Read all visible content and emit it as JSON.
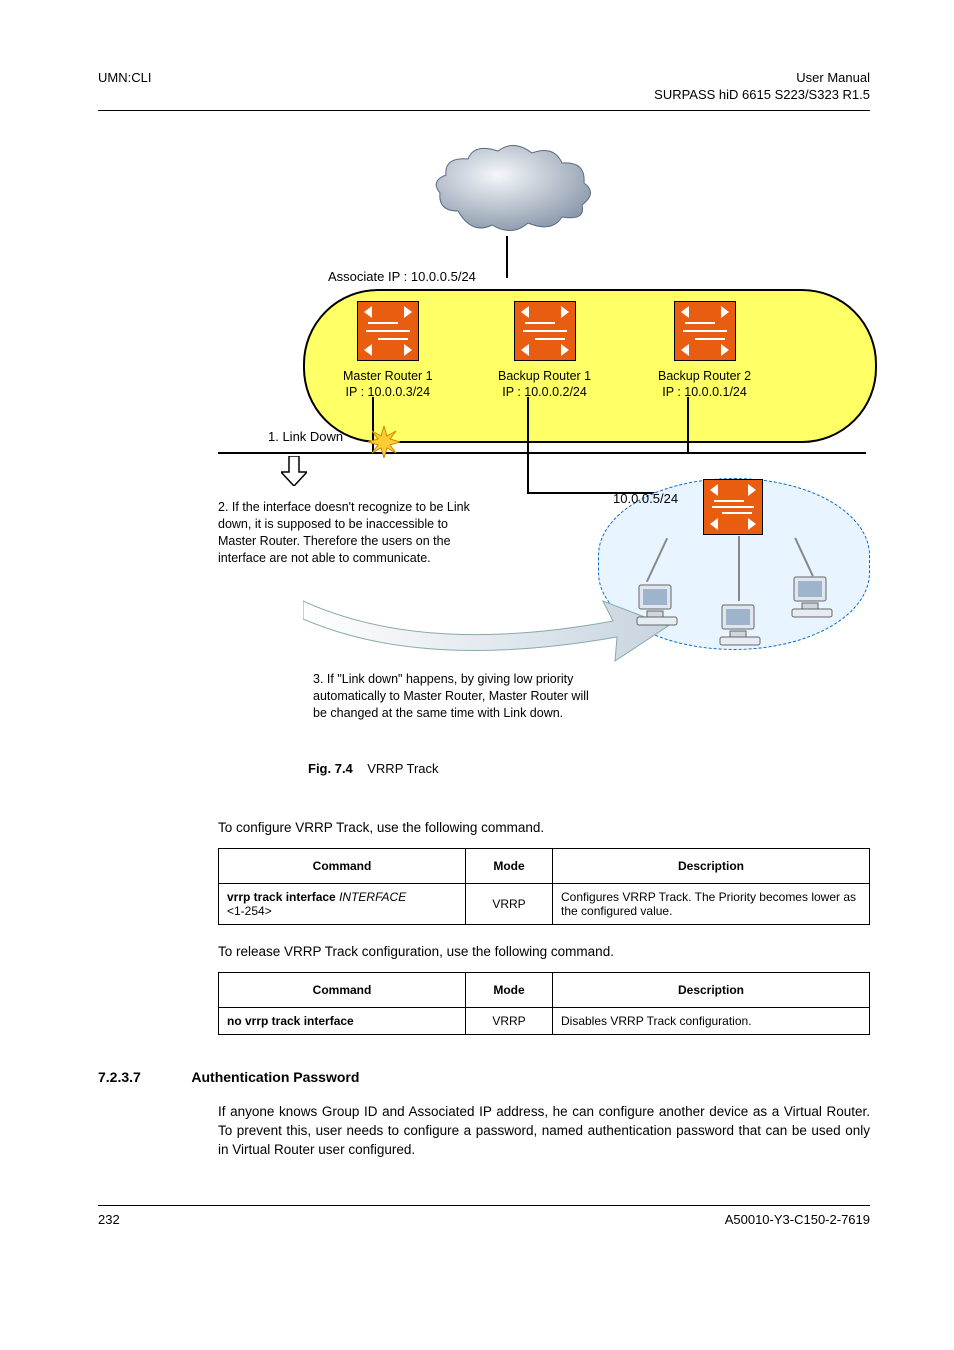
{
  "header": {
    "left": "UMN:CLI",
    "right1": "User Manual",
    "right2": "SURPASS hiD 6615 S223/S323 R1.5"
  },
  "diagram": {
    "assoc_ip": "Associate IP : 10.0.0.5/24",
    "router1_name": "Master Router 1",
    "router1_ip": "IP : 10.0.0.3/24",
    "router2_name": "Backup Router 1",
    "router2_ip": "IP : 10.0.0.2/24",
    "router3_name": "Backup Router 2",
    "router3_ip": "IP : 10.0.0.1/24",
    "linkdown": "1. Link Down",
    "para2": "2. If the interface doesn't recognize to be Link down, it is supposed to be inaccessible to  Master Router. Therefore the users on the interface are not able to communicate.",
    "para3": "3. If \"Link down\" happens, by giving low priority automatically to Master Router, Master Router will be changed at the same time with Link down.",
    "lan_ip": "10.0.0.5/24",
    "caption_num": "Fig. 7.4",
    "caption_text": "VRRP Track"
  },
  "para_configure": "To configure VRRP Track, use the following command.",
  "table1": {
    "h1": "Command",
    "h2": "Mode",
    "h3": "Description",
    "r1c1a": "vrrp track interface",
    "r1c1b": "INTERFACE",
    "r1c1c": "<1-254>",
    "r1c2": "VRRP",
    "r1c3": "Configures VRRP Track. The Priority becomes lower as the configured value."
  },
  "para_release": "To release VRRP Track configuration, use the following command.",
  "table2": {
    "h1": "Command",
    "h2": "Mode",
    "h3": "Description",
    "r1c1a": "no vrrp track interface",
    "r1c2": "VRRP",
    "r1c3": "Disables VRRP Track configuration."
  },
  "section": {
    "num": "7.2.3.7",
    "title": "Authentication Password",
    "body": "If anyone knows Group ID and Associated IP address, he can configure another device as a Virtual Router. To prevent this, user needs to configure a password, named authentication password that can be used only in Virtual Router user configured."
  },
  "footer": {
    "page": "232",
    "doc": "A50010-Y3-C150-2-7619"
  }
}
